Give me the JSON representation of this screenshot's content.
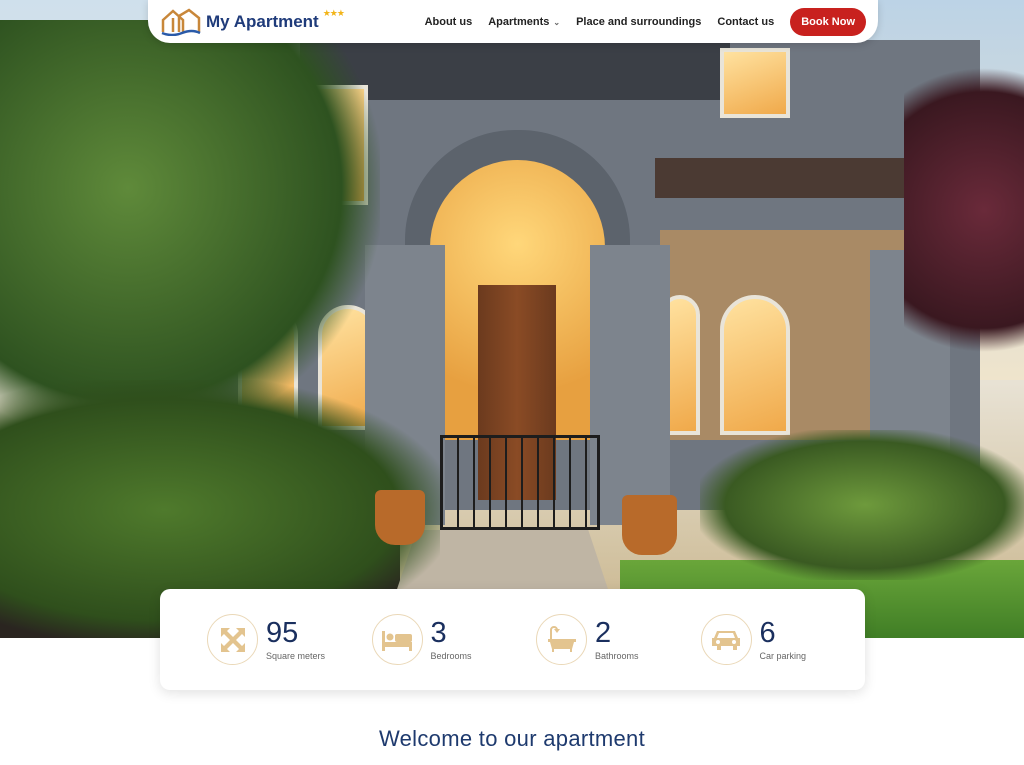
{
  "header": {
    "brand": "My Apartment",
    "brand_stars": "★★★",
    "nav": [
      {
        "label": "About us"
      },
      {
        "label": "Apartments",
        "chevron": "⌄"
      },
      {
        "label": "Place and surroundings"
      },
      {
        "label": "Contact us"
      }
    ],
    "cta": "Book Now"
  },
  "stats": [
    {
      "icon": "expand-arrows-icon",
      "value": "95",
      "label": "Square meters"
    },
    {
      "icon": "bed-icon",
      "value": "3",
      "label": "Bedrooms"
    },
    {
      "icon": "bathtub-icon",
      "value": "2",
      "label": "Bathrooms"
    },
    {
      "icon": "car-icon",
      "value": "6",
      "label": "Car parking"
    }
  ],
  "welcome": "Welcome to our apartment",
  "colors": {
    "brand": "#1f3b7a",
    "cta": "#c8211e",
    "icon": "#e3c48f",
    "stars": "#f2b418"
  }
}
